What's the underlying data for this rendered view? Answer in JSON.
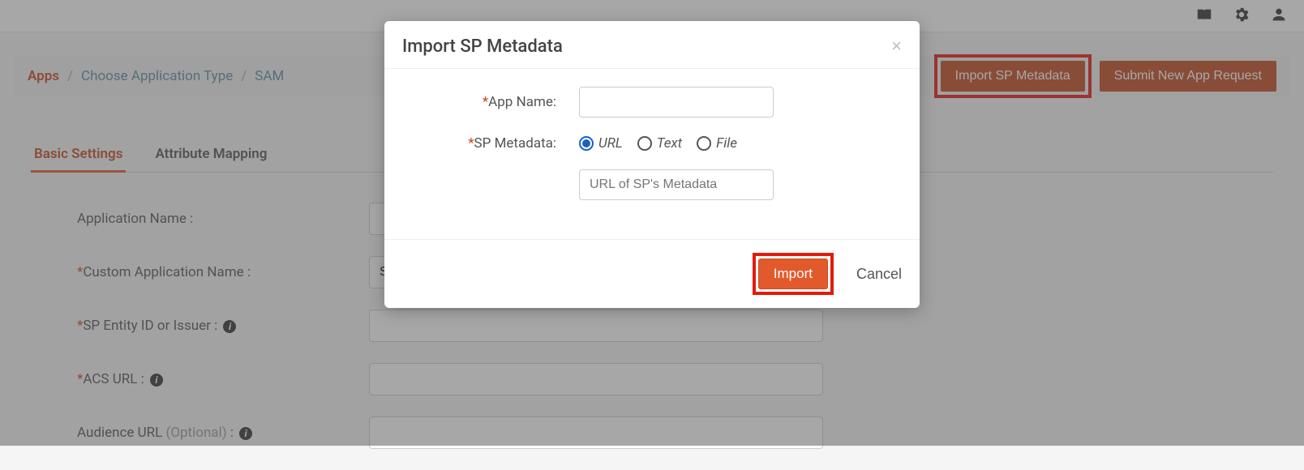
{
  "topbar": {
    "book_icon": "book-icon",
    "gear_icon": "gear-icon",
    "user_icon": "user-icon"
  },
  "breadcrumb": {
    "items": [
      "Apps",
      "Choose Application Type",
      "SAM"
    ]
  },
  "actions": {
    "import_sp": "Import SP Metadata",
    "submit_request": "Submit New App Request"
  },
  "tabs": {
    "basic": "Basic Settings",
    "attribute": "Attribute Mapping"
  },
  "form": {
    "application_name": {
      "label": "Application Name :",
      "value": ""
    },
    "custom_app_name": {
      "label": "Custom Application Name :",
      "value": "Salesforce"
    },
    "sp_entity": {
      "label": "SP Entity ID or Issuer :",
      "value": ""
    },
    "acs_url": {
      "label": "ACS URL :",
      "value": ""
    },
    "audience_url": {
      "label": "Audience URL",
      "optional": "(Optional)",
      "suffix": " :",
      "value": ""
    }
  },
  "modal": {
    "title": "Import SP Metadata",
    "app_name_label": "App Name:",
    "app_name_value": "",
    "sp_metadata_label": "SP Metadata:",
    "radio_url": "URL",
    "radio_text": "Text",
    "radio_file": "File",
    "metadata_placeholder": "URL of SP's Metadata",
    "metadata_value": "",
    "import_btn": "Import",
    "cancel_btn": "Cancel"
  }
}
